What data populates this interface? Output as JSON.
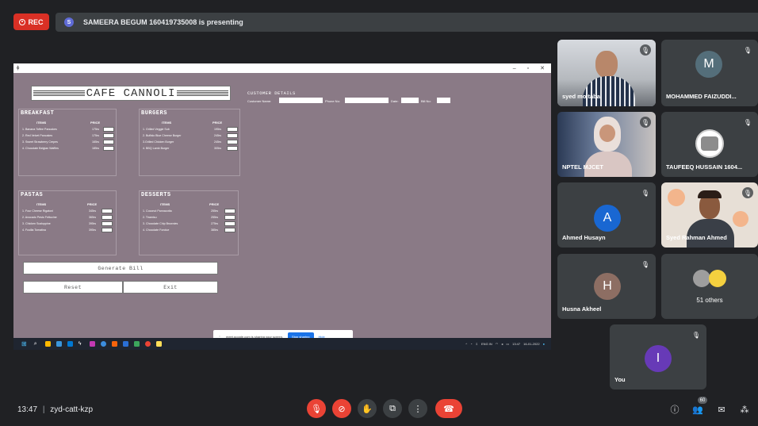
{
  "meet": {
    "rec_label": "REC",
    "presenter_initial": "S",
    "presenting_text": "SAMEERA BEGUM 160419735008 is presenting",
    "time": "13:47",
    "separator": "|",
    "meeting_code": "zyd-catt-kzp",
    "people_badge": "60",
    "accent_red": "#ea4335"
  },
  "app": {
    "title": "CAFE CANNOLI",
    "customer_heading": "CUSTOMER DETAILS",
    "customer_fields": [
      "Customer Name:",
      "Phone No:",
      "Date:",
      "Bill No:"
    ],
    "items_header": "ITEMS",
    "price_header": "PRICE",
    "sections": [
      {
        "name": "BREAKFAST",
        "items": [
          "1. Banana Toffee Pancakes",
          "2. Red Velvet Pancakes",
          "3. Sweet Strawberry Crepes",
          "4. Chocolate Belgian Waffles"
        ],
        "prices": [
          "175rs",
          "175rs",
          "165rs",
          "185rs"
        ]
      },
      {
        "name": "BURGERS",
        "items": [
          "1. Grilled Veggie Sub",
          "2. Buffalo Blue Cheese Burger",
          "3.Grilled Chicken Burger",
          "4. BBQ Lamb Burger"
        ],
        "prices": [
          "195rs",
          "245rs",
          "245rs",
          "305rs"
        ]
      },
      {
        "name": "PASTAS",
        "items": [
          "1. Four Cheese Rigatoni",
          "2. Avocado Pesto Fettucine",
          "3. Chicken Scaloppine",
          "4. Fusilla Tomatina"
        ],
        "prices": [
          "345rs",
          "365rs",
          "395rs",
          "395rs"
        ]
      },
      {
        "name": "DESSERTS",
        "items": [
          "1. Coconut Pannacotta",
          "2. Tiramisu",
          "3. Chocolate Chip Brownies",
          "4. Chocolate Fondue"
        ],
        "prices": [
          "255rs",
          "255rs",
          "275rs",
          "385rs"
        ]
      }
    ],
    "generate_label": "Generate Bill",
    "reset_label": "Reset",
    "exit_label": "Exit",
    "bg_color": "#8a7a86"
  },
  "share_bar": {
    "text": "meet.google.com is sharing your screen.",
    "stop_label": "Stop sharing",
    "hide_label": "Hide"
  },
  "taskbar": {
    "lang": "ENG IN",
    "clock": "13:47",
    "date": "16-01-2022"
  },
  "participants": [
    {
      "name": "syed mojtaba",
      "type": "video"
    },
    {
      "name": "MOHAMMED FAIZUDDI...",
      "initial": "M",
      "type": "avatar",
      "color": "#546e7a"
    },
    {
      "name": "NPTEL MJCET",
      "type": "video"
    },
    {
      "name": "TAUFEEQ HUSSAIN 1604...",
      "type": "logo"
    },
    {
      "name": "Ahmed Husayn",
      "initial": "A",
      "type": "avatar",
      "color": "#1967d2"
    },
    {
      "name": "Syed Rahman Ahmed",
      "type": "video"
    },
    {
      "name": "Husna Akheel",
      "initial": "H",
      "type": "avatar",
      "color": "#8d6e63"
    },
    {
      "name": "51 others",
      "type": "others"
    },
    {
      "name": "You",
      "initial": "I",
      "type": "avatar",
      "color": "#673ab7"
    }
  ]
}
